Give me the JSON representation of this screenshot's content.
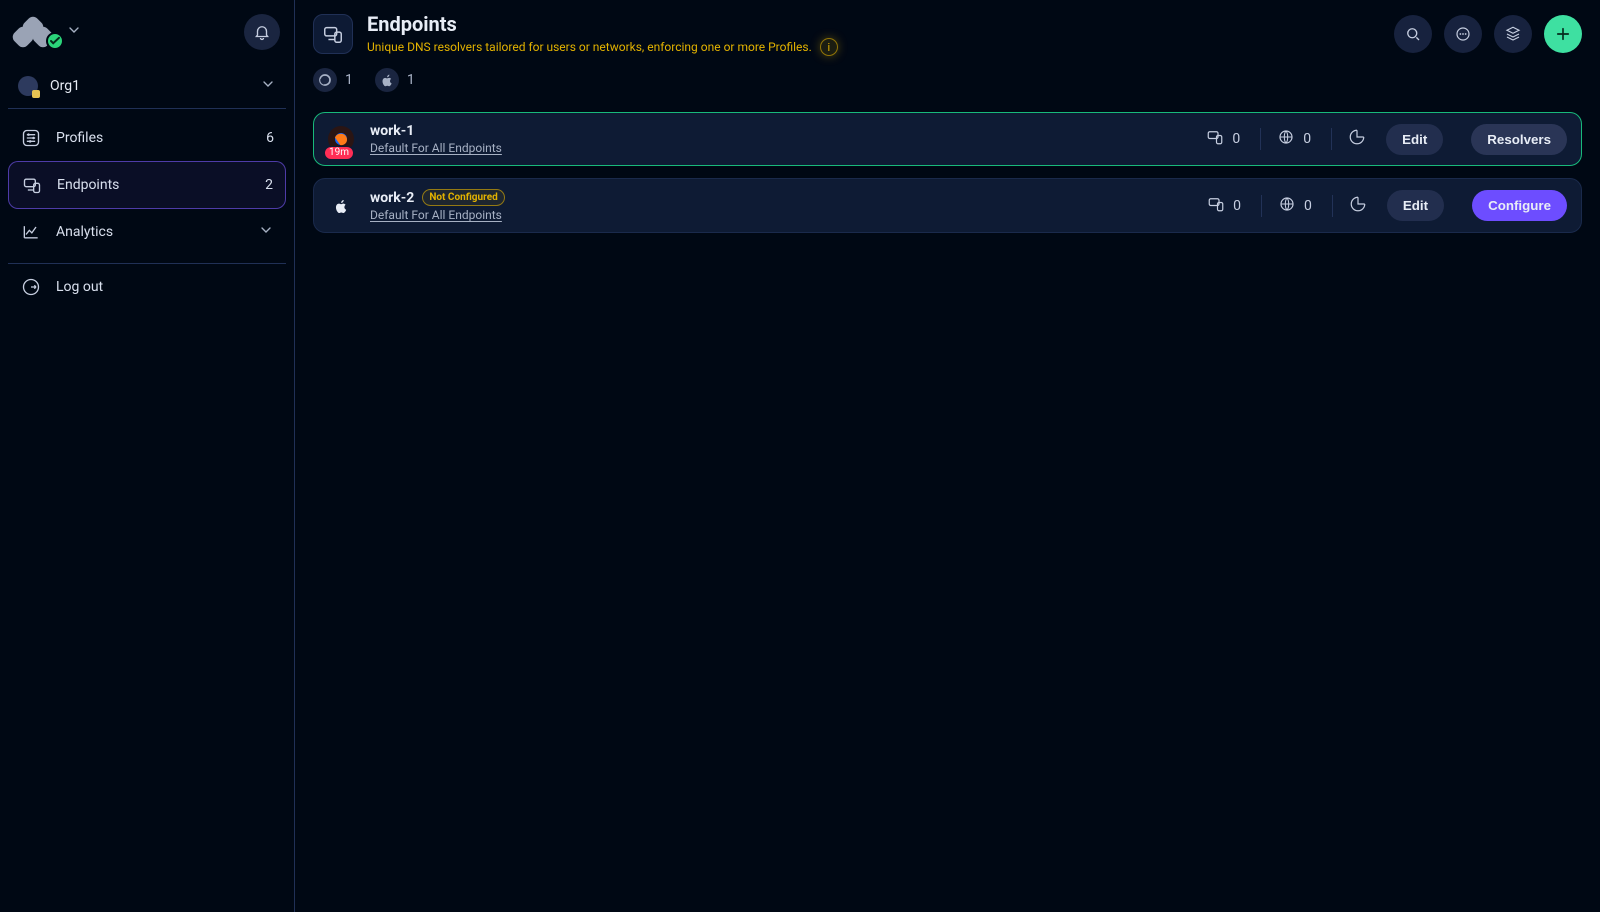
{
  "brand": {
    "status": "ok"
  },
  "org": {
    "name": "Org1"
  },
  "sidebar": {
    "items": [
      {
        "key": "profiles",
        "label": "Profiles",
        "count": 6
      },
      {
        "key": "endpoints",
        "label": "Endpoints",
        "count": 2
      },
      {
        "key": "analytics",
        "label": "Analytics"
      }
    ],
    "logout_label": "Log out"
  },
  "topbar": {
    "title": "Endpoints",
    "subtitle": "Unique DNS resolvers tailored for users or networks, enforcing one or more Profiles.",
    "info_symbol": "i"
  },
  "filters": {
    "firefox_count": 1,
    "apple_count": 1
  },
  "list": [
    {
      "key": "work-1",
      "name": "work-1",
      "os": "firefox",
      "badge": "19m",
      "sub": "Default For All Endpoints",
      "devices": 0,
      "domains": 0,
      "active": true,
      "actions": [
        "edit",
        "resolvers"
      ]
    },
    {
      "key": "work-2",
      "name": "work-2",
      "os": "apple",
      "tag": "Not Configured",
      "sub": "Default For All Endpoints",
      "devices": 0,
      "domains": 0,
      "active": false,
      "actions": [
        "edit",
        "configure"
      ]
    }
  ],
  "labels": {
    "edit": "Edit",
    "resolvers": "Resolvers",
    "configure": "Configure"
  }
}
